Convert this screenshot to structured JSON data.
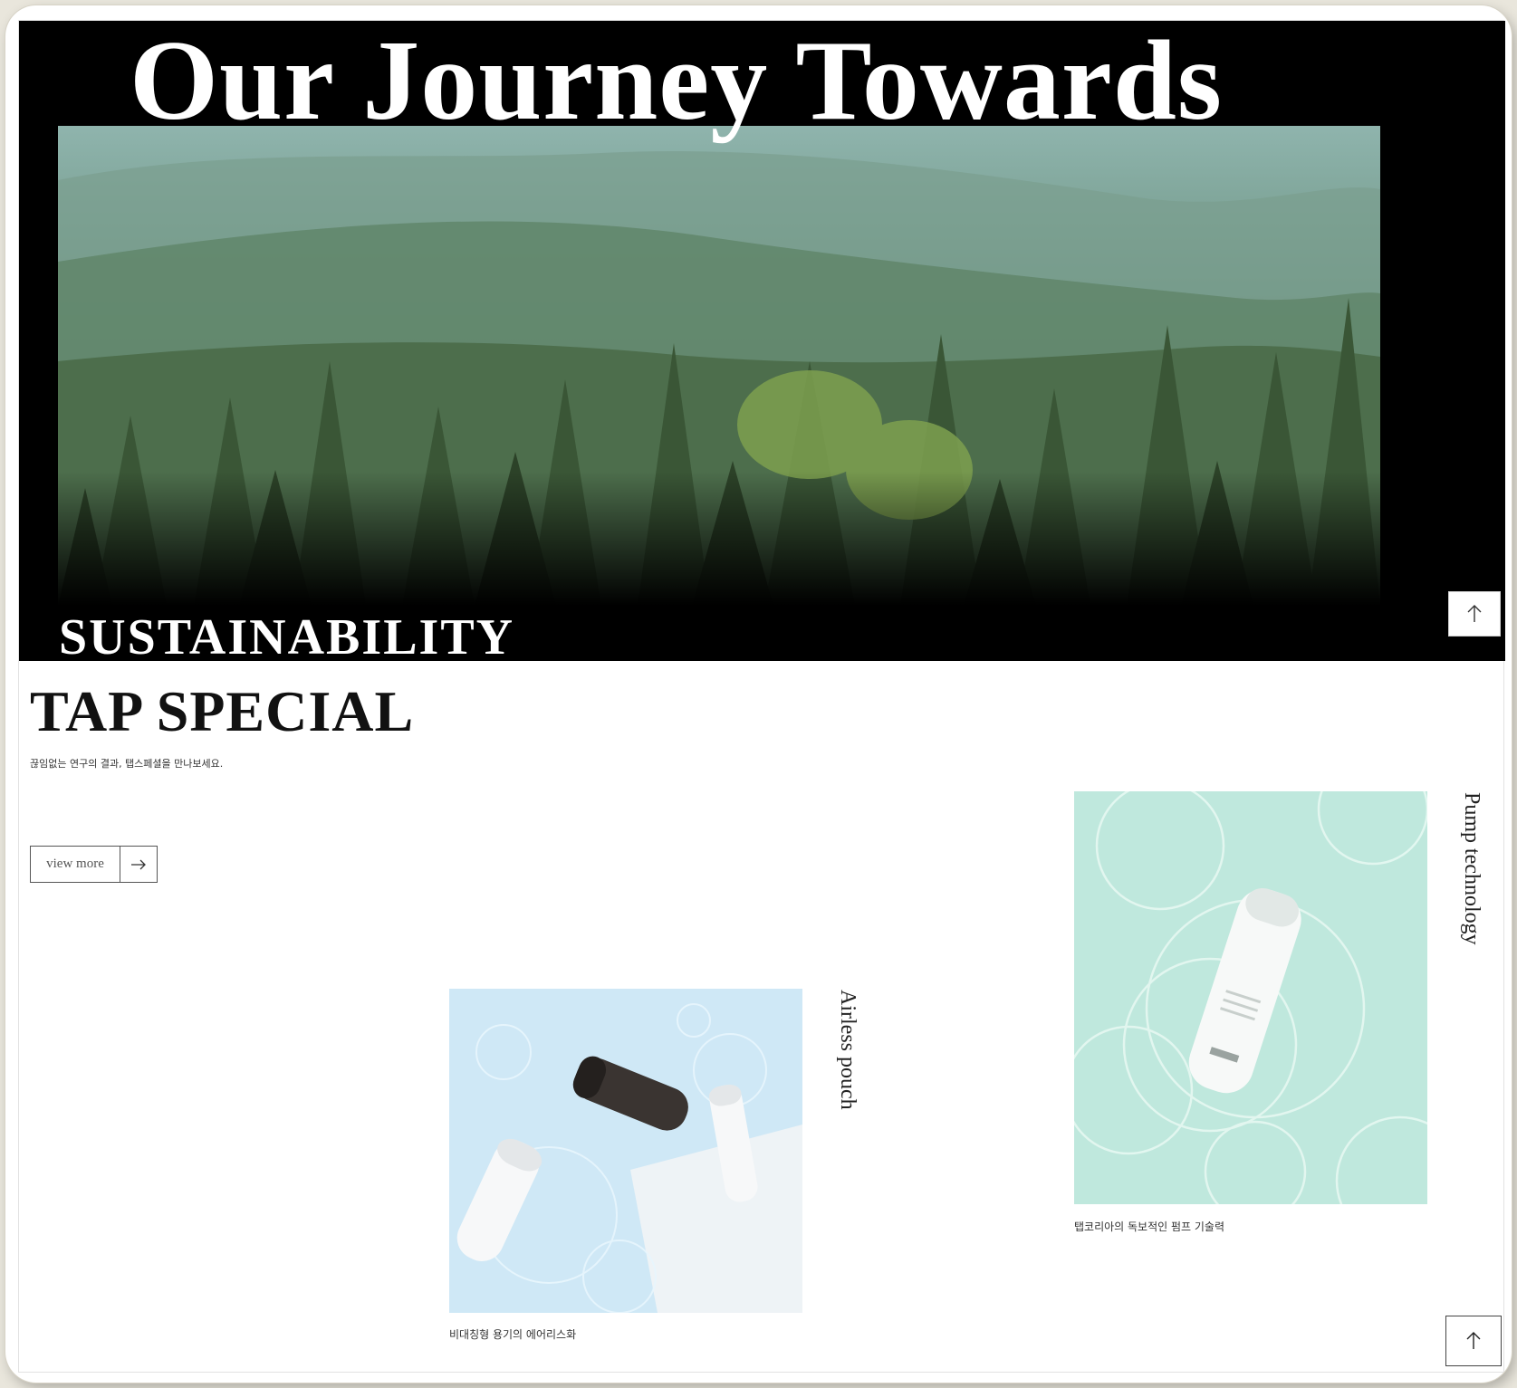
{
  "hero": {
    "title": "Our Journey Towards",
    "subtitle": "SUSTAINABILITY",
    "image": "forest-photo"
  },
  "tap_special": {
    "title": "TAP SPECIAL",
    "description": "끊임없는 연구의 결과, 탭스페셜을 만나보세요.",
    "view_more_label": "view more",
    "view_more_icon": "arrow-right-icon"
  },
  "products": [
    {
      "label": "Airless pouch",
      "caption": "비대칭형 용기의 에어리스화",
      "image": "airless-pouch-photo",
      "accent": "#cfe9f6"
    },
    {
      "label": "Pump technology",
      "caption": "탭코리아의 독보적인 펌프 기술력",
      "image": "pump-technology-photo",
      "accent": "#bfe9dd"
    }
  ],
  "scroll_top_icon": "arrow-up-icon",
  "colors": {
    "hero_bg": "#000000",
    "text_dark": "#111111",
    "page_bg": "#ffffff"
  }
}
